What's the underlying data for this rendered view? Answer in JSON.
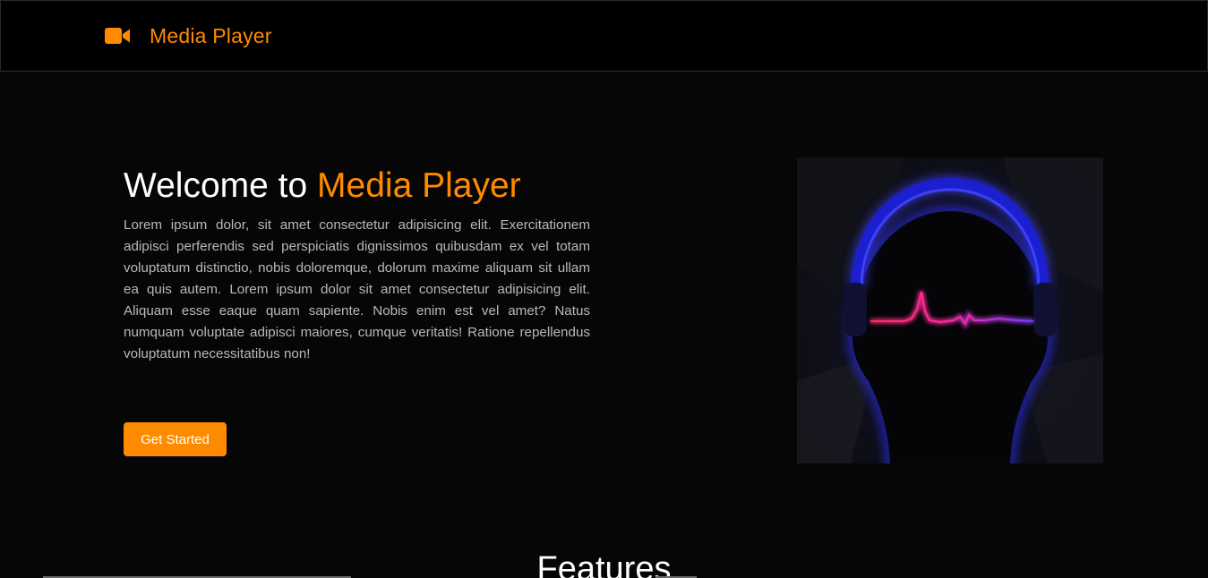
{
  "header": {
    "brand_icon": "video-camera-icon",
    "brand_name": "Media Player"
  },
  "hero": {
    "title_prefix": "Welcome to ",
    "title_accent": "Media Player",
    "description": "Lorem ipsum dolor, sit amet consectetur adipisicing elit. Exercitationem adipisci perferendis sed perspiciatis dignissimos quibusdam ex vel totam voluptatum distinctio, nobis doloremque, dolorum maxime aliquam sit ullam ea quis autem. Lorem ipsum dolor sit amet consectetur adipisicing elit. Aliquam esse eaque quam sapiente. Nobis enim est vel amet? Natus numquam voluptate adipisci maiores, cumque veritatis! Ratione repellendus voluptatum necessitatibus non!",
    "cta_label": "Get Started",
    "illustration": "headphones-soundwave-illustration"
  },
  "features": {
    "title": "Features"
  },
  "colors": {
    "accent": "#ff8a00",
    "background": "#060606",
    "text": "#ffffff",
    "muted_text": "#b9b9b9"
  }
}
